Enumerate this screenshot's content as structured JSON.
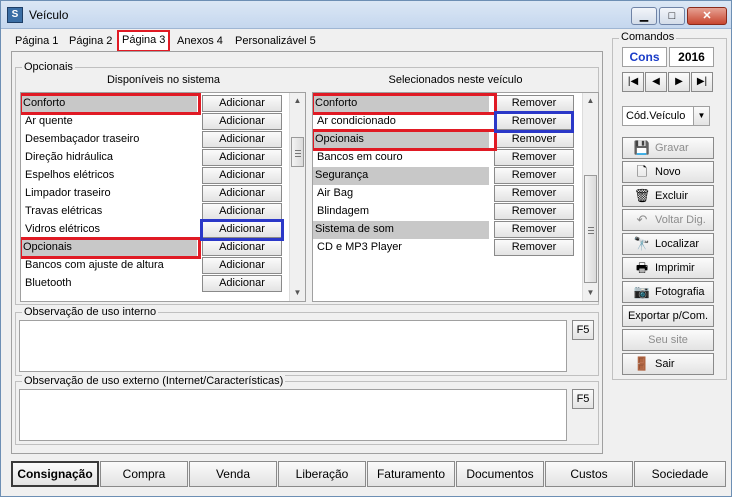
{
  "window": {
    "title": "Veículo",
    "minimize": "▁",
    "maximize": "□",
    "close": "✕",
    "icon": "app-icon"
  },
  "tabs": [
    {
      "label": "Página 1"
    },
    {
      "label": "Página 2"
    },
    {
      "label": "Página 3",
      "active": true
    },
    {
      "label": "Anexos 4"
    },
    {
      "label": "Personalizável 5"
    }
  ],
  "opcionais": {
    "group_title": "Opcionais",
    "available_header": "Disponíveis no sistema",
    "selected_header": "Selecionados neste veículo",
    "add_label": "Adicionar",
    "remove_label": "Remover",
    "available": [
      {
        "name": "Conforto",
        "category": true
      },
      {
        "name": "Ar quente"
      },
      {
        "name": "Desembaçador traseiro"
      },
      {
        "name": "Direção hidráulica"
      },
      {
        "name": "Espelhos elétricos"
      },
      {
        "name": "Limpador traseiro"
      },
      {
        "name": "Travas elétricas"
      },
      {
        "name": "Vidros elétricos"
      },
      {
        "name": "Opcionais",
        "category": true
      },
      {
        "name": "Bancos com ajuste de altura"
      },
      {
        "name": "Bluetooth"
      }
    ],
    "selected": [
      {
        "name": "Conforto",
        "category": true
      },
      {
        "name": "Ar condicionado"
      },
      {
        "name": "Opcionais",
        "category": true
      },
      {
        "name": "Bancos em couro"
      },
      {
        "name": "Segurança",
        "category": true
      },
      {
        "name": "Air Bag"
      },
      {
        "name": "Blindagem"
      },
      {
        "name": "Sistema de som",
        "category": true
      },
      {
        "name": "CD e MP3 Player"
      }
    ]
  },
  "obs_interno": {
    "label": "Observação de uso interno",
    "value": "",
    "f5": "F5"
  },
  "obs_externo": {
    "label": "Observação de uso externo (Internet/Características)",
    "value": "",
    "f5": "F5"
  },
  "bottom_buttons": [
    "Consignação",
    "Compra",
    "Venda",
    "Liberação",
    "Faturamento",
    "Documentos",
    "Custos",
    "Sociedade"
  ],
  "commands": {
    "title": "Comandos",
    "mode": "Cons",
    "year": "2016",
    "nav": [
      "|◀",
      "◀",
      "▶",
      "▶|"
    ],
    "combo_value": "Cód.Veículo",
    "buttons": [
      {
        "label": "Gravar",
        "icon": "save-icon",
        "glyph": "💾",
        "disabled": true
      },
      {
        "label": "Novo",
        "icon": "new-document-icon",
        "glyph": "🗋"
      },
      {
        "label": "Excluir",
        "icon": "trash-icon",
        "glyph": "🗑"
      },
      {
        "label": "Voltar Dig.",
        "icon": "undo-icon",
        "glyph": "↶",
        "disabled": true
      },
      {
        "label": "Localizar",
        "icon": "binoculars-icon",
        "glyph": "🔭"
      },
      {
        "label": "Imprimir",
        "icon": "printer-icon",
        "glyph": "🖶"
      },
      {
        "label": "Fotografia",
        "icon": "camera-icon",
        "glyph": "📷"
      },
      {
        "label": "Exportar p/Com.",
        "icon": ""
      },
      {
        "label": "Seu site",
        "icon": "",
        "disabled": true
      },
      {
        "label": "Sair",
        "icon": "exit-icon",
        "glyph": "🚪"
      }
    ]
  },
  "colors": {
    "highlight_red": "#e01a24",
    "highlight_blue": "#2b38c8",
    "category_gray": "#c8c8c8",
    "cons_blue": "#1a3cc8"
  }
}
